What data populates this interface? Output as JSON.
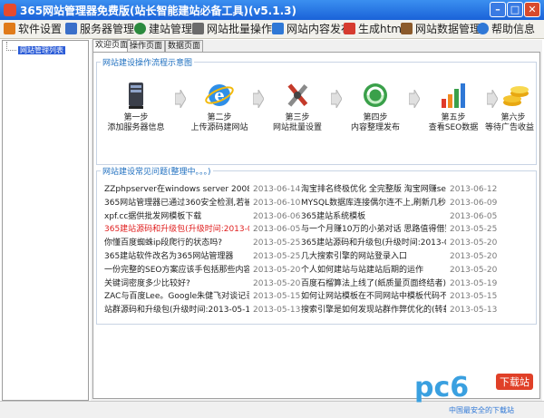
{
  "window": {
    "title": "365网站管理器免费版(站长智能建站必备工具)(v5.1.3)"
  },
  "menu": [
    {
      "label": "软件设置",
      "icon": "wrench-icon",
      "color": "#e07b1a"
    },
    {
      "label": "服务器管理",
      "icon": "server-icon",
      "color": "#3a6fc9"
    },
    {
      "label": "建站管理",
      "icon": "globe-icon",
      "color": "#2b8a3e"
    },
    {
      "label": "网站批量操作",
      "icon": "grid-icon",
      "color": "#6b6b6b"
    },
    {
      "label": "网站内容发布",
      "icon": "document-icon",
      "color": "#2f78d6"
    },
    {
      "label": "生成html",
      "icon": "arrow-icon",
      "color": "#d63b2f"
    },
    {
      "label": "网站数据管理",
      "icon": "database-icon",
      "color": "#8b5a2b"
    },
    {
      "label": "帮助信息",
      "icon": "help-icon",
      "color": "#2f78d6"
    }
  ],
  "tree": {
    "item": "网站管理列表"
  },
  "tabs": [
    "欢迎页面",
    "操作页面",
    "数据页面"
  ],
  "flow": {
    "title": "网站建设操作流程示意图",
    "steps": [
      {
        "step": "第一步",
        "desc": "添加服务器信息",
        "icon": "server-icon"
      },
      {
        "step": "第二步",
        "desc": "上传源码建网站",
        "icon": "ie-globe-icon"
      },
      {
        "step": "第三步",
        "desc": "网站批量设置",
        "icon": "tools-icon"
      },
      {
        "step": "第四步",
        "desc": "内容整理发布",
        "icon": "recycle-icon"
      },
      {
        "step": "第五步",
        "desc": "查看SEO数据",
        "icon": "bar-chart-icon"
      },
      {
        "step": "第六步",
        "desc": "等待广告收益",
        "icon": "coins-icon"
      }
    ]
  },
  "faq": {
    "title": "网站建设常见问题(整理中。。。)",
    "left": [
      {
        "text": "ZZphpserver在windows server 2008 64位",
        "date": "2013-06-14",
        "red": false
      },
      {
        "text": "365网站管理器已通过360安全检测,若被拦",
        "date": "2013-06-10",
        "red": false
      },
      {
        "text": "xpf.cc据供批发网模板下载",
        "date": "2013-06-06",
        "red": false
      },
      {
        "text": "365建站源码和升级包(升级时间:2013-06-",
        "date": "2013-06-05",
        "red": true
      },
      {
        "text": "你懂百度蜘蛛ip段爬行的状态吗?",
        "date": "2013-05-25",
        "red": false
      },
      {
        "text": "365建站软件改名为365网站管理器",
        "date": "2013-05-25",
        "red": false
      },
      {
        "text": "一份完整的SEO方案应该手包括那些内容",
        "date": "2013-05-20",
        "red": false
      },
      {
        "text": "关键词密度多少比较好?",
        "date": "2013-05-20",
        "red": false
      },
      {
        "text": "ZAC与百度Lee。Google朱健飞对谈记录",
        "date": "2013-05-15",
        "red": false
      },
      {
        "text": "站群源码和升级包(升级时间:2013-05-13)",
        "date": "2013-05-13",
        "red": false
      }
    ],
    "right": [
      {
        "text": "淘宝排名终极优化 全完整版 淘宝网赚seo",
        "date": "2013-06-12"
      },
      {
        "text": "MYSQL数据库连接偶尔连不上,刷新几秒后",
        "date": "2013-06-09"
      },
      {
        "text": "365建站系统模板",
        "date": "2013-06-05"
      },
      {
        "text": "与一个月赚10万的小弟对话 思路值得借鉴",
        "date": "2013-05-25"
      },
      {
        "text": "365建站源码和升级包(升级时间:2013-05-",
        "date": "2013-05-20"
      },
      {
        "text": "几大搜索引擎的网站登录入口",
        "date": "2013-05-20"
      },
      {
        "text": "个人如何建站与站建站后期的运作",
        "date": "2013-05-20"
      },
      {
        "text": "百度石榴算法上线了(紙质量页面终结者)",
        "date": "2013-05-19"
      },
      {
        "text": "如何让网站模板在不同网站中模板代码不一",
        "date": "2013-05-15"
      },
      {
        "text": "搜索引擎是如何发现站群作弊优化的(转载",
        "date": "2013-05-13"
      }
    ]
  },
  "watermark": {
    "logo": "pc6",
    "badge": "下载站",
    "tagline": "中国最安全的下载站"
  }
}
